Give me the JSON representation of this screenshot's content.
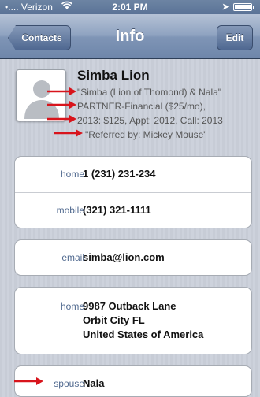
{
  "status_bar": {
    "carrier": "•.... Verizon",
    "wifi_icon": "wifi-icon",
    "time": "2:01 PM",
    "location_icon": "location-arrow-icon",
    "battery_icon": "battery-icon"
  },
  "nav": {
    "back_label": "Contacts",
    "title": "Info",
    "edit_label": "Edit"
  },
  "contact": {
    "name": "Simba Lion",
    "notes": [
      "\"Simba (Lion of Thomond) & Nala\"",
      "PARTNER-Financial ($25/mo),",
      "2013: $125, Appt: 2012, Call: 2013",
      "\"Referred by: Mickey Mouse\""
    ],
    "avatar_icon": "person-placeholder-icon"
  },
  "phones": [
    {
      "label": "home",
      "value": "1 (231) 231-234"
    },
    {
      "label": "mobile",
      "value": "(321) 321-1111"
    }
  ],
  "email": {
    "label": "email",
    "value": "simba@lion.com"
  },
  "address": {
    "label": "home",
    "lines": [
      "9987 Outback Lane",
      "Orbit City FL",
      "United States of America"
    ]
  },
  "related": {
    "label": "spouse",
    "value": "Nala"
  },
  "colors": {
    "annotation_arrow": "#d8141c",
    "nav_bar": "#7f95b6",
    "field_label": "#50698f"
  }
}
